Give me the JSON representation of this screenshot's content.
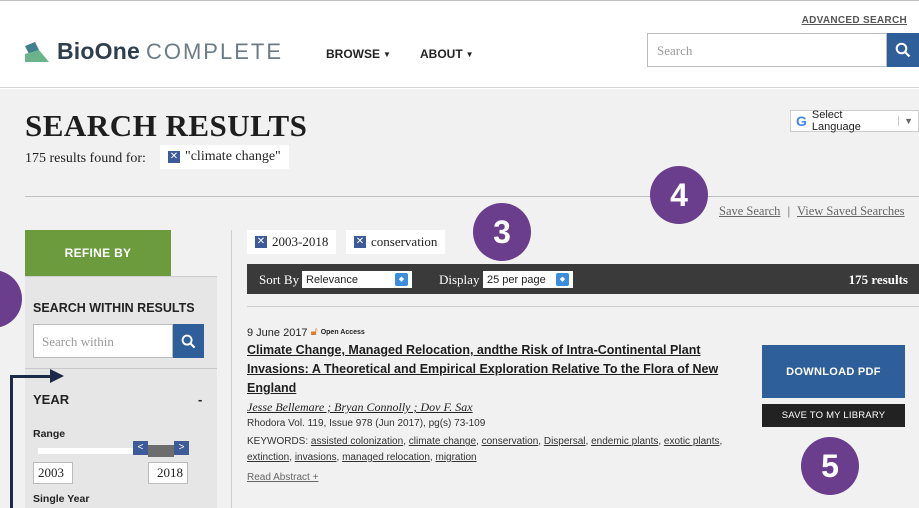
{
  "header": {
    "brand_bold": "BioOne",
    "brand_light": "COMPLETE",
    "nav": [
      "BROWSE",
      "ABOUT"
    ],
    "advanced_search": "ADVANCED SEARCH",
    "search_placeholder": "Search"
  },
  "page": {
    "title": "SEARCH RESULTS",
    "found_text": "175 results found for:",
    "query": "\"climate change\"",
    "language": "Select Language"
  },
  "saved": {
    "save_search": "Save Search",
    "separator": "|",
    "view_saved": "View Saved Searches"
  },
  "badges": [
    "3",
    "4",
    "5"
  ],
  "sidebar": {
    "refine": "REFINE BY",
    "search_within_title": "SEARCH WITHIN RESULTS",
    "within_placeholder": "Search within",
    "year_title": "YEAR",
    "year_toggle": "-",
    "range_label": "Range",
    "year_from": "2003",
    "year_to": "2018",
    "single_year": "Single Year"
  },
  "filters": [
    "2003-2018",
    "conservation"
  ],
  "sortbar": {
    "sort_label": "Sort By",
    "sort_value": "Relevance",
    "display_label": "Display",
    "display_value": "25 per page",
    "count": "175 results"
  },
  "result": {
    "date": "9 June 2017",
    "access": "Open Access",
    "title": "Climate Change, Managed Relocation, andthe Risk of Intra-Continental Plant Invasions: A Theoretical and Empirical Exploration Relative To the Flora of New England",
    "authors": "Jesse Bellemare ; Bryan Connolly ; Dov F. Sax",
    "journal": "Rhodora Vol. 119, Issue 978 (Jun 2017), pg(s) 73-109",
    "keywords_label": "KEYWORDS:",
    "keywords": [
      "assisted colonization",
      "climate change",
      "conservation",
      "Dispersal",
      "endemic plants",
      "exotic plants",
      "extinction",
      "invasions",
      "managed relocation",
      "migration"
    ],
    "read_abstract": "Read Abstract +",
    "download": "DOWNLOAD PDF",
    "save_library": "SAVE TO MY LIBRARY"
  },
  "colors": {
    "brand_blue": "#2f5f9a",
    "refine_green": "#6b9b3c",
    "badge_purple": "#6b3d8d"
  }
}
